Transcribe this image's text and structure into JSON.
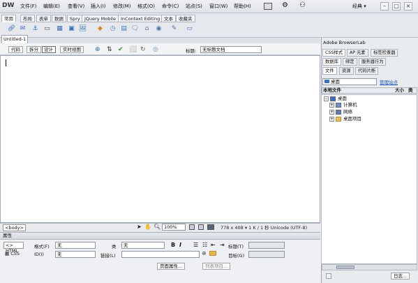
{
  "app": {
    "logo": "DW"
  },
  "menu": {
    "items": [
      "文件(F)",
      "编辑(E)",
      "查看(V)",
      "插入(I)",
      "修改(M)",
      "格式(O)",
      "命令(C)",
      "站点(S)",
      "窗口(W)",
      "帮助(H)"
    ],
    "classic": "经典 ▾"
  },
  "insert": {
    "tabs": [
      "常用",
      "布局",
      "表单",
      "数据",
      "Spry",
      "jQuery Mobile",
      "InContext Editing",
      "文本",
      "收藏夹"
    ]
  },
  "document": {
    "tab": "Untitled-1",
    "view_buttons": [
      "代码",
      "拆分",
      "设计",
      "实时视图"
    ],
    "title_label": "标题:",
    "title_value": "无标题文档"
  },
  "status": {
    "tag": "<body>",
    "zoom": "100%",
    "size": "778 x 408 ▾ 1 K / 1 秒 Unicode (UTF-8)"
  },
  "properties": {
    "header": "属性",
    "html": "HTML",
    "css": "CSS",
    "format_label": "格式(F)",
    "format_value": "无",
    "class_label": "类",
    "class_value": "无",
    "id_label": "ID(I)",
    "id_value": "无",
    "link_label": "链接(L)",
    "link_value": "",
    "title_label": "标题(T)",
    "target_label": "目标(G)",
    "page_props": "页面属性...",
    "list_item": "列表项目..."
  },
  "right_panel": {
    "browserlab": "Adobe BrowserLab",
    "tabs_row1": [
      "CSS样式",
      "AP 元素",
      "标签检查器"
    ],
    "tabs_row2": [
      "数据库",
      "绑定",
      "服务器行为"
    ],
    "tabs_row3": [
      "文件",
      "资源",
      "代码片断"
    ],
    "site_select": "桌面",
    "manage": "管理站点",
    "columns": [
      "本地文件",
      "大小",
      "类"
    ],
    "tree": [
      {
        "label": "桌面",
        "level": 0
      },
      {
        "label": "计算机",
        "level": 1
      },
      {
        "label": "网络",
        "level": 1
      },
      {
        "label": "桌面项目",
        "level": 1
      }
    ],
    "log": "日志..."
  }
}
